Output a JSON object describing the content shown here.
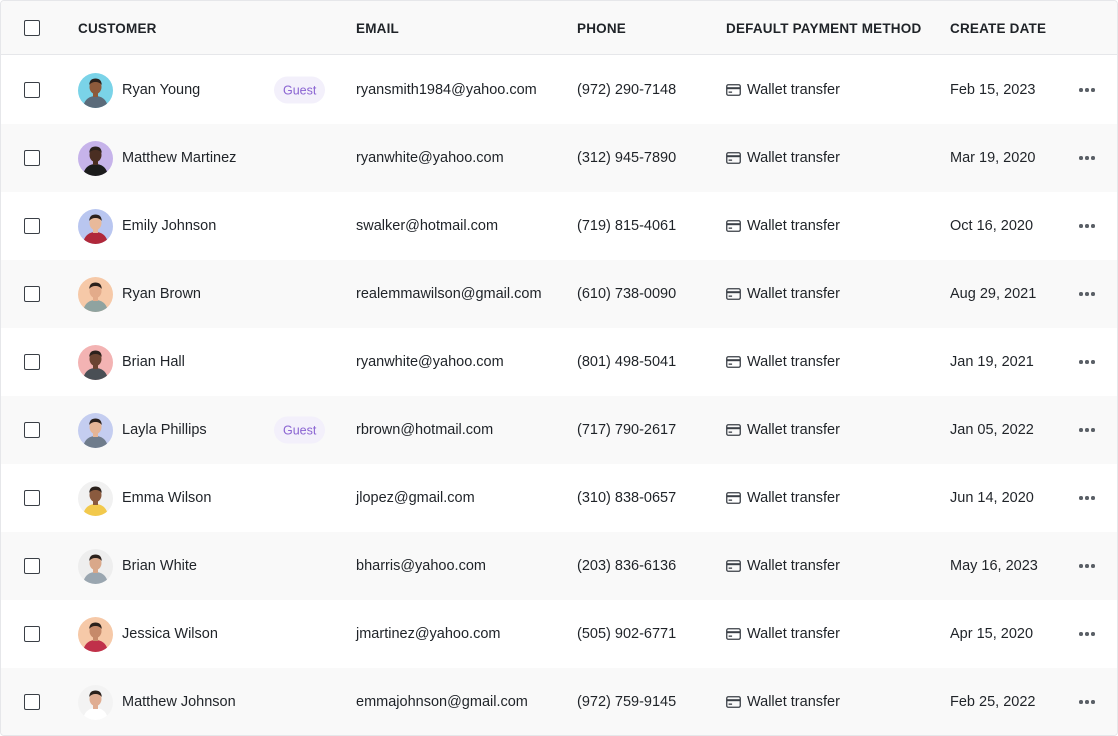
{
  "header": {
    "customer": "CUSTOMER",
    "email": "EMAIL",
    "phone": "PHONE",
    "payment": "DEFAULT PAYMENT METHOD",
    "date": "CREATE DATE"
  },
  "colors": {
    "badge_bg": "#f3f0fb",
    "badge_text": "#8a63d2",
    "row_alt": "#f9f9f9"
  },
  "rows": [
    {
      "name": "Ryan Young",
      "badge": "Guest",
      "email": "ryansmith1984@yahoo.com",
      "phone": "(972) 290-7148",
      "payment": "Wallet transfer",
      "payment_icon": "credit-card-icon",
      "date": "Feb 15, 2023",
      "avatar_bg": "#7ad3e8",
      "skin": "#8d5a3b",
      "shirt": "#5b6b7a"
    },
    {
      "name": "Matthew Martinez",
      "badge": "",
      "email": "ryanwhite@yahoo.com",
      "phone": "(312) 945-7890",
      "payment": "Wallet transfer",
      "payment_icon": "credit-card-icon",
      "date": "Mar 19, 2020",
      "avatar_bg": "#c6b3ea",
      "skin": "#4a2e22",
      "shirt": "#1c1c1c"
    },
    {
      "name": "Emily Johnson",
      "badge": "",
      "email": "swalker@hotmail.com",
      "phone": "(719) 815-4061",
      "payment": "Wallet transfer",
      "payment_icon": "credit-card-icon",
      "date": "Oct 16, 2020",
      "avatar_bg": "#b9c6f0",
      "skin": "#e8b99a",
      "shirt": "#b0283a"
    },
    {
      "name": "Ryan Brown",
      "badge": "",
      "email": "realemmawilson@gmail.com",
      "phone": "(610) 738-0090",
      "payment": "Wallet transfer",
      "payment_icon": "credit-card-icon",
      "date": "Aug 29, 2021",
      "avatar_bg": "#f6c9a8",
      "skin": "#e3ab8a",
      "shirt": "#8fa3a0"
    },
    {
      "name": "Brian Hall",
      "badge": "",
      "email": "ryanwhite@yahoo.com",
      "phone": "(801) 498-5041",
      "payment": "Wallet transfer",
      "payment_icon": "credit-card-icon",
      "date": "Jan 19, 2021",
      "avatar_bg": "#f3b3b3",
      "skin": "#6b4432",
      "shirt": "#4a4f55"
    },
    {
      "name": "Layla Phillips",
      "badge": "Guest",
      "email": "rbrown@hotmail.com",
      "phone": "(717) 790-2617",
      "payment": "Wallet transfer",
      "payment_icon": "credit-card-icon",
      "date": "Jan 05, 2022",
      "avatar_bg": "#c4cdf0",
      "skin": "#e5b596",
      "shirt": "#6f7c8c"
    },
    {
      "name": "Emma Wilson",
      "badge": "",
      "email": "jlopez@gmail.com",
      "phone": "(310) 838-0657",
      "payment": "Wallet transfer",
      "payment_icon": "credit-card-icon",
      "date": "Jun 14, 2020",
      "avatar_bg": "#f1f1f1",
      "skin": "#8a5a3e",
      "shirt": "#f2c94c"
    },
    {
      "name": "Brian White",
      "badge": "",
      "email": "bharris@yahoo.com",
      "phone": "(203) 836-6136",
      "payment": "Wallet transfer",
      "payment_icon": "credit-card-icon",
      "date": "May 16, 2023",
      "avatar_bg": "#eeeeee",
      "skin": "#d9a88a",
      "shirt": "#9aa6b0"
    },
    {
      "name": "Jessica Wilson",
      "badge": "",
      "email": "jmartinez@yahoo.com",
      "phone": "(505) 902-6771",
      "payment": "Wallet transfer",
      "payment_icon": "credit-card-icon",
      "date": "Apr 15, 2020",
      "avatar_bg": "#f6c9a8",
      "skin": "#c68a6a",
      "shirt": "#c0304a"
    },
    {
      "name": "Matthew Johnson",
      "badge": "",
      "email": "emmajohnson@gmail.com",
      "phone": "(972) 759-9145",
      "payment": "Wallet transfer",
      "payment_icon": "credit-card-icon",
      "date": "Feb 25, 2022",
      "avatar_bg": "#f3f3f3",
      "skin": "#e0ad92",
      "shirt": "#ffffff"
    }
  ]
}
